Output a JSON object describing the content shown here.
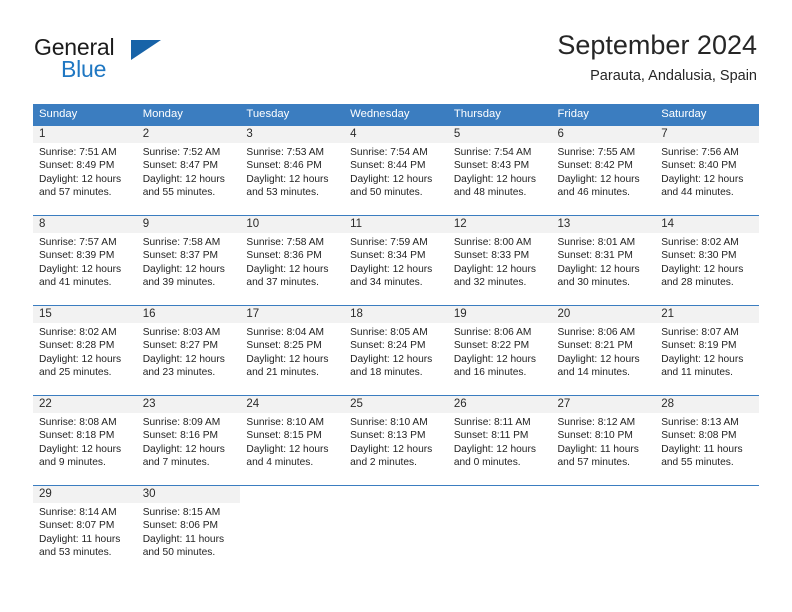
{
  "brand": {
    "name_part1": "General",
    "name_part2": "Blue",
    "accent_color": "#1763a8"
  },
  "header": {
    "title": "September 2024",
    "location": "Parauta, Andalusia, Spain"
  },
  "calendar": {
    "header_color": "#3b7dc0",
    "daynum_band_color": "#f2f2f2",
    "day_headers": [
      "Sunday",
      "Monday",
      "Tuesday",
      "Wednesday",
      "Thursday",
      "Friday",
      "Saturday"
    ],
    "weeks": [
      [
        {
          "day": "1",
          "sunrise": "Sunrise: 7:51 AM",
          "sunset": "Sunset: 8:49 PM",
          "daylight_line1": "Daylight: 12 hours",
          "daylight_line2": "and 57 minutes."
        },
        {
          "day": "2",
          "sunrise": "Sunrise: 7:52 AM",
          "sunset": "Sunset: 8:47 PM",
          "daylight_line1": "Daylight: 12 hours",
          "daylight_line2": "and 55 minutes."
        },
        {
          "day": "3",
          "sunrise": "Sunrise: 7:53 AM",
          "sunset": "Sunset: 8:46 PM",
          "daylight_line1": "Daylight: 12 hours",
          "daylight_line2": "and 53 minutes."
        },
        {
          "day": "4",
          "sunrise": "Sunrise: 7:54 AM",
          "sunset": "Sunset: 8:44 PM",
          "daylight_line1": "Daylight: 12 hours",
          "daylight_line2": "and 50 minutes."
        },
        {
          "day": "5",
          "sunrise": "Sunrise: 7:54 AM",
          "sunset": "Sunset: 8:43 PM",
          "daylight_line1": "Daylight: 12 hours",
          "daylight_line2": "and 48 minutes."
        },
        {
          "day": "6",
          "sunrise": "Sunrise: 7:55 AM",
          "sunset": "Sunset: 8:42 PM",
          "daylight_line1": "Daylight: 12 hours",
          "daylight_line2": "and 46 minutes."
        },
        {
          "day": "7",
          "sunrise": "Sunrise: 7:56 AM",
          "sunset": "Sunset: 8:40 PM",
          "daylight_line1": "Daylight: 12 hours",
          "daylight_line2": "and 44 minutes."
        }
      ],
      [
        {
          "day": "8",
          "sunrise": "Sunrise: 7:57 AM",
          "sunset": "Sunset: 8:39 PM",
          "daylight_line1": "Daylight: 12 hours",
          "daylight_line2": "and 41 minutes."
        },
        {
          "day": "9",
          "sunrise": "Sunrise: 7:58 AM",
          "sunset": "Sunset: 8:37 PM",
          "daylight_line1": "Daylight: 12 hours",
          "daylight_line2": "and 39 minutes."
        },
        {
          "day": "10",
          "sunrise": "Sunrise: 7:58 AM",
          "sunset": "Sunset: 8:36 PM",
          "daylight_line1": "Daylight: 12 hours",
          "daylight_line2": "and 37 minutes."
        },
        {
          "day": "11",
          "sunrise": "Sunrise: 7:59 AM",
          "sunset": "Sunset: 8:34 PM",
          "daylight_line1": "Daylight: 12 hours",
          "daylight_line2": "and 34 minutes."
        },
        {
          "day": "12",
          "sunrise": "Sunrise: 8:00 AM",
          "sunset": "Sunset: 8:33 PM",
          "daylight_line1": "Daylight: 12 hours",
          "daylight_line2": "and 32 minutes."
        },
        {
          "day": "13",
          "sunrise": "Sunrise: 8:01 AM",
          "sunset": "Sunset: 8:31 PM",
          "daylight_line1": "Daylight: 12 hours",
          "daylight_line2": "and 30 minutes."
        },
        {
          "day": "14",
          "sunrise": "Sunrise: 8:02 AM",
          "sunset": "Sunset: 8:30 PM",
          "daylight_line1": "Daylight: 12 hours",
          "daylight_line2": "and 28 minutes."
        }
      ],
      [
        {
          "day": "15",
          "sunrise": "Sunrise: 8:02 AM",
          "sunset": "Sunset: 8:28 PM",
          "daylight_line1": "Daylight: 12 hours",
          "daylight_line2": "and 25 minutes."
        },
        {
          "day": "16",
          "sunrise": "Sunrise: 8:03 AM",
          "sunset": "Sunset: 8:27 PM",
          "daylight_line1": "Daylight: 12 hours",
          "daylight_line2": "and 23 minutes."
        },
        {
          "day": "17",
          "sunrise": "Sunrise: 8:04 AM",
          "sunset": "Sunset: 8:25 PM",
          "daylight_line1": "Daylight: 12 hours",
          "daylight_line2": "and 21 minutes."
        },
        {
          "day": "18",
          "sunrise": "Sunrise: 8:05 AM",
          "sunset": "Sunset: 8:24 PM",
          "daylight_line1": "Daylight: 12 hours",
          "daylight_line2": "and 18 minutes."
        },
        {
          "day": "19",
          "sunrise": "Sunrise: 8:06 AM",
          "sunset": "Sunset: 8:22 PM",
          "daylight_line1": "Daylight: 12 hours",
          "daylight_line2": "and 16 minutes."
        },
        {
          "day": "20",
          "sunrise": "Sunrise: 8:06 AM",
          "sunset": "Sunset: 8:21 PM",
          "daylight_line1": "Daylight: 12 hours",
          "daylight_line2": "and 14 minutes."
        },
        {
          "day": "21",
          "sunrise": "Sunrise: 8:07 AM",
          "sunset": "Sunset: 8:19 PM",
          "daylight_line1": "Daylight: 12 hours",
          "daylight_line2": "and 11 minutes."
        }
      ],
      [
        {
          "day": "22",
          "sunrise": "Sunrise: 8:08 AM",
          "sunset": "Sunset: 8:18 PM",
          "daylight_line1": "Daylight: 12 hours",
          "daylight_line2": "and 9 minutes."
        },
        {
          "day": "23",
          "sunrise": "Sunrise: 8:09 AM",
          "sunset": "Sunset: 8:16 PM",
          "daylight_line1": "Daylight: 12 hours",
          "daylight_line2": "and 7 minutes."
        },
        {
          "day": "24",
          "sunrise": "Sunrise: 8:10 AM",
          "sunset": "Sunset: 8:15 PM",
          "daylight_line1": "Daylight: 12 hours",
          "daylight_line2": "and 4 minutes."
        },
        {
          "day": "25",
          "sunrise": "Sunrise: 8:10 AM",
          "sunset": "Sunset: 8:13 PM",
          "daylight_line1": "Daylight: 12 hours",
          "daylight_line2": "and 2 minutes."
        },
        {
          "day": "26",
          "sunrise": "Sunrise: 8:11 AM",
          "sunset": "Sunset: 8:11 PM",
          "daylight_line1": "Daylight: 12 hours",
          "daylight_line2": "and 0 minutes."
        },
        {
          "day": "27",
          "sunrise": "Sunrise: 8:12 AM",
          "sunset": "Sunset: 8:10 PM",
          "daylight_line1": "Daylight: 11 hours",
          "daylight_line2": "and 57 minutes."
        },
        {
          "day": "28",
          "sunrise": "Sunrise: 8:13 AM",
          "sunset": "Sunset: 8:08 PM",
          "daylight_line1": "Daylight: 11 hours",
          "daylight_line2": "and 55 minutes."
        }
      ],
      [
        {
          "day": "29",
          "sunrise": "Sunrise: 8:14 AM",
          "sunset": "Sunset: 8:07 PM",
          "daylight_line1": "Daylight: 11 hours",
          "daylight_line2": "and 53 minutes."
        },
        {
          "day": "30",
          "sunrise": "Sunrise: 8:15 AM",
          "sunset": "Sunset: 8:06 PM",
          "daylight_line1": "Daylight: 11 hours",
          "daylight_line2": "and 50 minutes."
        },
        {
          "day": "",
          "sunrise": "",
          "sunset": "",
          "daylight_line1": "",
          "daylight_line2": ""
        },
        {
          "day": "",
          "sunrise": "",
          "sunset": "",
          "daylight_line1": "",
          "daylight_line2": ""
        },
        {
          "day": "",
          "sunrise": "",
          "sunset": "",
          "daylight_line1": "",
          "daylight_line2": ""
        },
        {
          "day": "",
          "sunrise": "",
          "sunset": "",
          "daylight_line1": "",
          "daylight_line2": ""
        },
        {
          "day": "",
          "sunrise": "",
          "sunset": "",
          "daylight_line1": "",
          "daylight_line2": ""
        }
      ]
    ]
  }
}
